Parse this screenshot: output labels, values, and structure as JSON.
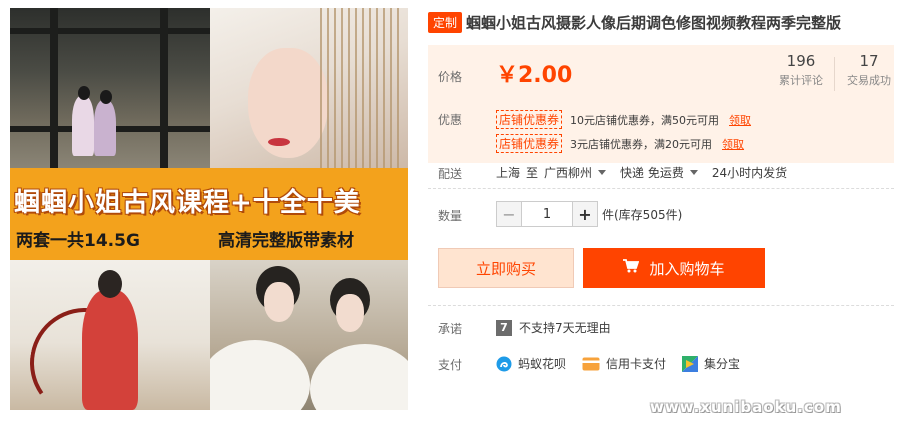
{
  "gallery": {
    "banner_main": "蝈蝈小姐古风课程+十全十美",
    "banner_sub_left": "两套一共14.5G",
    "banner_sub_right": "高清完整版带素材"
  },
  "product": {
    "tag": "定制",
    "title": "蝈蝈小姐古风摄影人像后期调色修图视频教程两季完整版"
  },
  "price": {
    "label": "价格",
    "value": "￥2.00",
    "reviews_count": "196",
    "reviews_label": "累计评论",
    "sales_count": "17",
    "sales_label": "交易成功"
  },
  "promo": {
    "label": "优惠",
    "coupons": [
      {
        "badge": "店铺优惠券",
        "text": "10元店铺优惠券，满50元可用",
        "link": "领取"
      },
      {
        "badge": "店铺优惠券",
        "text": "3元店铺优惠券，满20元可用",
        "link": "领取"
      }
    ]
  },
  "shipping": {
    "label": "配送",
    "from": "上海",
    "to_word": "至",
    "destination": "广西柳州",
    "method": "快递 免运费",
    "dispatch": "24小时内发货"
  },
  "quantity": {
    "label": "数量",
    "minus": "−",
    "value": "1",
    "plus": "+",
    "stock": "件(库存505件)"
  },
  "actions": {
    "buy_now": "立即购买",
    "add_cart": "加入购物车"
  },
  "promise": {
    "label": "承诺",
    "icon_text": "7",
    "text": "不支持7天无理由"
  },
  "payment": {
    "label": "支付",
    "methods": [
      "蚂蚁花呗",
      "信用卡支付",
      "集分宝"
    ]
  },
  "watermark": "www.xunibaoku.com",
  "colors": {
    "accent": "#ff4400",
    "price_bg": "#fff2e8",
    "banner": "#f3a21c"
  }
}
